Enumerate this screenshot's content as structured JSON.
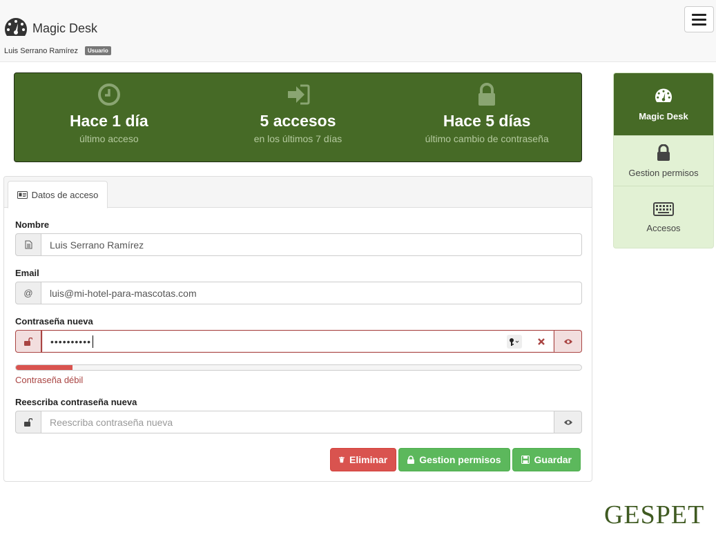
{
  "header": {
    "app_title": "Magic Desk",
    "user_name": "Luis Serrano Ramírez",
    "user_role": "Usuario"
  },
  "stats": [
    {
      "icon": "clock-icon",
      "value": "Hace 1 día",
      "label": "último acceso"
    },
    {
      "icon": "sign-in-icon",
      "value": "5 accesos",
      "label": "en los últimos 7 días"
    },
    {
      "icon": "lock-icon",
      "value": "Hace 5 días",
      "label": "último cambio de contraseña"
    }
  ],
  "side_nav": [
    {
      "icon": "dashboard-icon",
      "label": "Magic Desk",
      "active": true
    },
    {
      "icon": "lock-icon",
      "label": "Gestion permisos",
      "active": false
    },
    {
      "icon": "keyboard-icon",
      "label": "Accesos",
      "active": false
    }
  ],
  "tab": {
    "icon": "id-card-icon",
    "label": "Datos de acceso"
  },
  "form": {
    "name": {
      "label": "Nombre",
      "value": "Luis Serrano Ramírez"
    },
    "email": {
      "label": "Email",
      "addon": "@",
      "value": "luis@mi-hotel-para-mascotas.com"
    },
    "new_password": {
      "label": "Contraseña nueva",
      "value": "••••••••••",
      "strength_fraction": 0.1,
      "strength_text": "Contraseña débil"
    },
    "repeat_password": {
      "label": "Reescriba contraseña nueva",
      "placeholder": "Reescriba contraseña nueva"
    }
  },
  "buttons": {
    "delete": "Eliminar",
    "permissions": "Gestion permisos",
    "save": "Guardar"
  },
  "colors": {
    "brand_green": "#466a26",
    "nav_light_green": "#e2f1d4",
    "danger": "#d9534f",
    "success": "#5cb85c",
    "error_text": "#a94442"
  },
  "logo_text": "GESPET"
}
